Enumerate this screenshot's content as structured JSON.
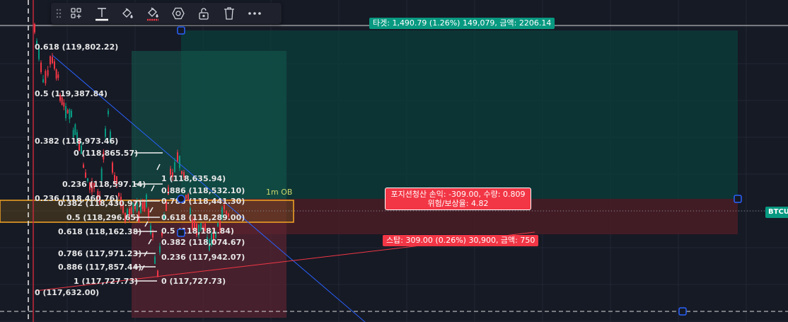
{
  "app": {
    "name": "trading-chart-drawing-tools"
  },
  "toolbar": {
    "items": [
      {
        "icon": "grip-icon"
      },
      {
        "icon": "template-grid-icon"
      },
      {
        "icon": "text-icon"
      },
      {
        "icon": "line-color-icon"
      },
      {
        "icon": "fill-color-icon",
        "color": "#f23645"
      },
      {
        "icon": "settings-hexagon-icon"
      },
      {
        "icon": "lock-icon"
      },
      {
        "icon": "trash-icon"
      },
      {
        "icon": "more-icon"
      }
    ]
  },
  "position": {
    "target_label": "타겟: 1,490.79 (1.26%) 149,079, 금액: 2206.14",
    "info_line1": "포지션청산 손익: -309.00, 수량: 0.809",
    "info_line2": "위험/보상율: 4.82",
    "stop_label": "스탑: 309.00 (0.26%) 30,900, 금액: 750",
    "target_color": "#089981",
    "stop_color": "#f23645"
  },
  "ob_label": "1m OB",
  "symbol_tag": "BTCU",
  "fib_left": {
    "levels": [
      "0.618 (119,802.22)",
      "0.5 (119,387.84)",
      "0.382 (118,973.46)",
      "0.236 (118,460.76)",
      "0 (117,632.00)"
    ]
  },
  "fib_mid": {
    "levels": [
      "0 (118,865.57)",
      "0.236 (118,597.14)",
      "0.382 (118,430.97)",
      "0.5 (118,296.65)",
      "0.618 (118,162.38)",
      "0.786 (117,971.23)",
      "0.886 (117,857.44)",
      "1 (117,727.73)"
    ]
  },
  "fib_right": {
    "levels": [
      "1 (118,635.94)",
      "0.886 (118,532.10)",
      "0.786 (118,441.30)",
      "0.618 (118,289.00)",
      "0.5 (118,181.84)",
      "0.382 (118,074.67)",
      "0.236 (117,942.07)",
      "0 (117,727.73)"
    ]
  }
}
